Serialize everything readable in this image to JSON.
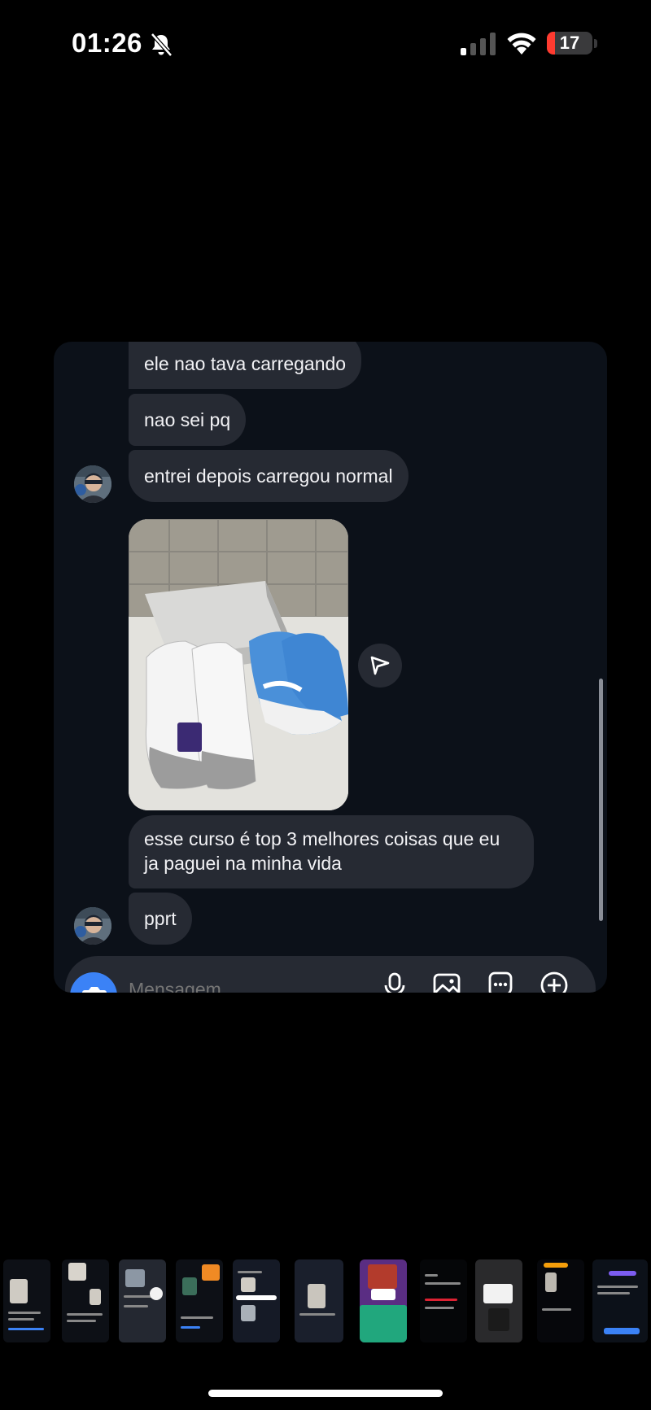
{
  "status_bar": {
    "time": "01:26",
    "silent_icon": "bell-slash-icon",
    "signal_icon": "cellular-signal-icon",
    "wifi_icon": "wifi-icon",
    "battery_level": "17",
    "battery_fraction": 0.17,
    "battery_color": "#ff3b30"
  },
  "chat": {
    "messages": [
      {
        "text": "ele nao tava carregando"
      },
      {
        "text": "nao sei pq"
      },
      {
        "text": "entrei depois carregou normal"
      },
      {
        "text": "esse curso é top 3 melhores coisas que eu ja paguei na minha vida"
      },
      {
        "text": "pprt"
      }
    ],
    "photo_icon": "sneakers-photo",
    "share_icon": "paper-plane-icon"
  },
  "composer": {
    "placeholder": "Mensagem...",
    "camera_icon": "camera-icon",
    "mic_icon": "microphone-icon",
    "gallery_icon": "image-icon",
    "sticker_icon": "sticker-icon",
    "plus_icon": "plus-icon",
    "accent": "#3b82f6"
  },
  "thumbnails": {
    "count": 11,
    "selected_index": 6
  }
}
